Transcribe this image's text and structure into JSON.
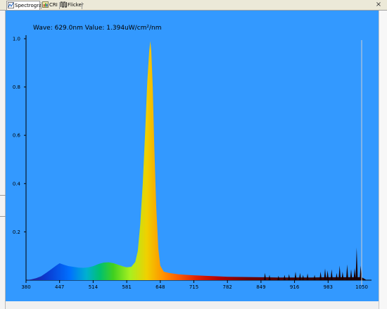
{
  "tabs": [
    {
      "label": "Spectrogram",
      "icon": "spectrogram-icon",
      "active": true
    },
    {
      "label": "CRI",
      "icon": "cri-icon",
      "active": false
    },
    {
      "label": "Flicker",
      "icon": "flicker-icon",
      "active": false
    }
  ],
  "window": {
    "close_glyph": "×"
  },
  "readout": {
    "text": "Wave: 629.0nm  Value: 1.394uW/cm²/nm"
  },
  "colors": {
    "background": "#3399ff",
    "axis": "#000000"
  },
  "chart_data": {
    "type": "area",
    "title": "",
    "xlabel": "",
    "ylabel": "",
    "xlim": [
      380,
      1065
    ],
    "ylim": [
      0,
      1.0
    ],
    "x_ticks": [
      "380",
      "447",
      "514",
      "581",
      "648",
      "715",
      "782",
      "849",
      "916",
      "983",
      "1050"
    ],
    "y_ticks": [
      "0.2",
      "0.4",
      "0.6",
      "0.8",
      "1.0"
    ],
    "grid": false,
    "legend": "none",
    "cursor_wavelength": 629.0,
    "points": [
      [
        380,
        0.0
      ],
      [
        390,
        0.003
      ],
      [
        400,
        0.008
      ],
      [
        410,
        0.016
      ],
      [
        420,
        0.03
      ],
      [
        430,
        0.045
      ],
      [
        440,
        0.06
      ],
      [
        447,
        0.07
      ],
      [
        455,
        0.064
      ],
      [
        465,
        0.058
      ],
      [
        475,
        0.055
      ],
      [
        485,
        0.052
      ],
      [
        495,
        0.051
      ],
      [
        505,
        0.053
      ],
      [
        514,
        0.058
      ],
      [
        525,
        0.067
      ],
      [
        535,
        0.073
      ],
      [
        545,
        0.074
      ],
      [
        555,
        0.07
      ],
      [
        565,
        0.063
      ],
      [
        575,
        0.056
      ],
      [
        581,
        0.053
      ],
      [
        590,
        0.055
      ],
      [
        598,
        0.075
      ],
      [
        603,
        0.12
      ],
      [
        608,
        0.23
      ],
      [
        613,
        0.4
      ],
      [
        618,
        0.62
      ],
      [
        622,
        0.82
      ],
      [
        626,
        0.95
      ],
      [
        628,
        0.99
      ],
      [
        630,
        0.95
      ],
      [
        633,
        0.8
      ],
      [
        636,
        0.55
      ],
      [
        640,
        0.3
      ],
      [
        644,
        0.13
      ],
      [
        648,
        0.06
      ],
      [
        655,
        0.035
      ],
      [
        665,
        0.03
      ],
      [
        675,
        0.027
      ],
      [
        685,
        0.024
      ],
      [
        700,
        0.022
      ],
      [
        715,
        0.02
      ],
      [
        735,
        0.018
      ],
      [
        760,
        0.016
      ],
      [
        782,
        0.014
      ],
      [
        810,
        0.013
      ],
      [
        849,
        0.012
      ],
      [
        880,
        0.011
      ],
      [
        916,
        0.011
      ],
      [
        950,
        0.011
      ],
      [
        983,
        0.012
      ],
      [
        1020,
        0.012
      ],
      [
        1050,
        0.012
      ],
      [
        1060,
        0.0
      ]
    ],
    "spikes": [
      [
        857,
        0.03
      ],
      [
        866,
        0.022
      ],
      [
        884,
        0.018
      ],
      [
        896,
        0.022
      ],
      [
        905,
        0.025
      ],
      [
        918,
        0.035
      ],
      [
        927,
        0.03
      ],
      [
        933,
        0.022
      ],
      [
        942,
        0.028
      ],
      [
        956,
        0.022
      ],
      [
        968,
        0.035
      ],
      [
        977,
        0.048
      ],
      [
        982,
        0.04
      ],
      [
        990,
        0.045
      ],
      [
        1000,
        0.03
      ],
      [
        1006,
        0.06
      ],
      [
        1012,
        0.035
      ],
      [
        1021,
        0.065
      ],
      [
        1029,
        0.045
      ],
      [
        1036,
        0.05
      ],
      [
        1040,
        0.135
      ],
      [
        1048,
        0.06
      ]
    ]
  }
}
